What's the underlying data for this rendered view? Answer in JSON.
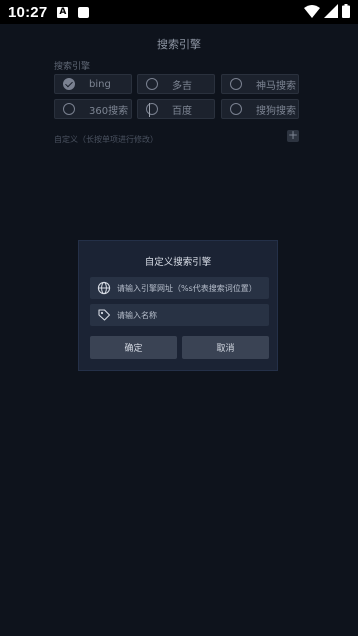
{
  "status_bar": {
    "time": "10:27",
    "notification_icon_a": "A"
  },
  "header": {
    "title": "搜索引擎"
  },
  "engines_section": {
    "label": "搜索引擎",
    "items": [
      {
        "label": "bing",
        "selected": true
      },
      {
        "label": "多吉",
        "selected": false
      },
      {
        "label": "神马搜索",
        "selected": false
      },
      {
        "label": "360搜索",
        "selected": false
      },
      {
        "label": "百度",
        "selected": false
      },
      {
        "label": "搜狗搜索",
        "selected": false
      }
    ]
  },
  "custom_section": {
    "label": "自定义（长按单项进行修改）",
    "add_label": "+"
  },
  "dialog": {
    "title": "自定义搜索引擎",
    "url_placeholder": "请输入引擎网址（%s代表搜索词位置）",
    "name_placeholder": "请输入名称",
    "confirm_label": "确定",
    "cancel_label": "取消"
  },
  "colors": {
    "background": "#0e131c",
    "dialog": "#1b2334",
    "field": "#283244",
    "button": "#3a4354"
  }
}
